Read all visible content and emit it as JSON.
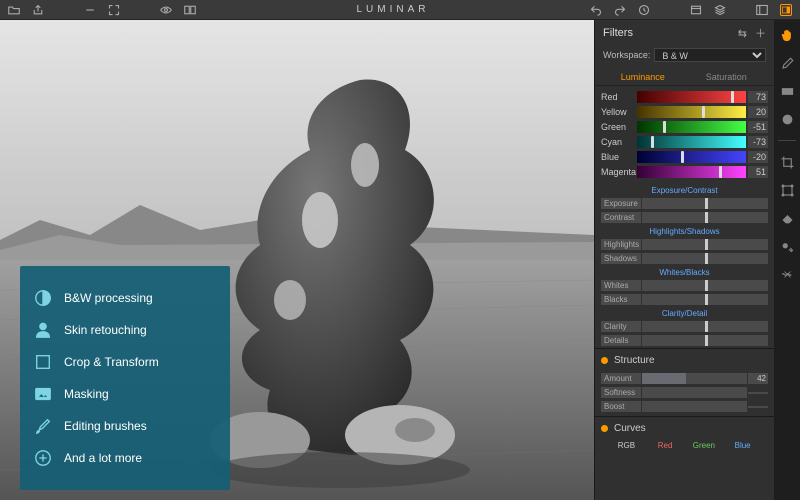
{
  "app": {
    "title": "LUMINAR"
  },
  "feature_overlay": {
    "items": [
      {
        "label": "B&W processing",
        "icon": "bw-circle"
      },
      {
        "label": "Skin retouching",
        "icon": "person"
      },
      {
        "label": "Crop & Transform",
        "icon": "square"
      },
      {
        "label": "Masking",
        "icon": "mask"
      },
      {
        "label": "Editing brushes",
        "icon": "brush"
      },
      {
        "label": "And a lot more",
        "icon": "plus-circle"
      }
    ]
  },
  "filters": {
    "panel_title": "Filters",
    "workspace_label": "Workspace:",
    "workspace_value": "B & W",
    "tabs": {
      "luminance": "Luminance",
      "saturation": "Saturation",
      "active": "luminance"
    },
    "color_sliders": [
      {
        "name": "Red",
        "value": 73,
        "gradient": [
          "#400",
          "#f44"
        ],
        "handle_pct": 86
      },
      {
        "name": "Yellow",
        "value": 20,
        "gradient": [
          "#430",
          "#fe4"
        ],
        "handle_pct": 60
      },
      {
        "name": "Green",
        "value": -51,
        "gradient": [
          "#030",
          "#4f4"
        ],
        "handle_pct": 24
      },
      {
        "name": "Cyan",
        "value": -73,
        "gradient": [
          "#033",
          "#4ff"
        ],
        "handle_pct": 13
      },
      {
        "name": "Blue",
        "value": -20,
        "gradient": [
          "#003",
          "#44f"
        ],
        "handle_pct": 40
      },
      {
        "name": "Magenta",
        "value": 51,
        "gradient": [
          "#303",
          "#f4f"
        ],
        "handle_pct": 75
      }
    ],
    "groups": [
      {
        "label": "Exposure/Contrast",
        "sliders": [
          "Exposure",
          "Contrast"
        ]
      },
      {
        "label": "Highlights/Shadows",
        "sliders": [
          "Highlights",
          "Shadows"
        ]
      },
      {
        "label": "Whites/Blacks",
        "sliders": [
          "Whites",
          "Blacks"
        ]
      },
      {
        "label": "Clarity/Detail",
        "sliders": [
          "Clarity",
          "Details"
        ]
      }
    ],
    "structure": {
      "title": "Structure",
      "sliders": [
        {
          "name": "Amount",
          "value": 42,
          "fill_pct": 42
        },
        {
          "name": "Softness",
          "value": "",
          "fill_pct": 0
        },
        {
          "name": "Boost",
          "value": "",
          "fill_pct": 0
        }
      ]
    },
    "curves": {
      "title": "Curves",
      "channels": {
        "rgb": "RGB",
        "red": "Red",
        "green": "Green",
        "blue": "Blue"
      }
    }
  }
}
